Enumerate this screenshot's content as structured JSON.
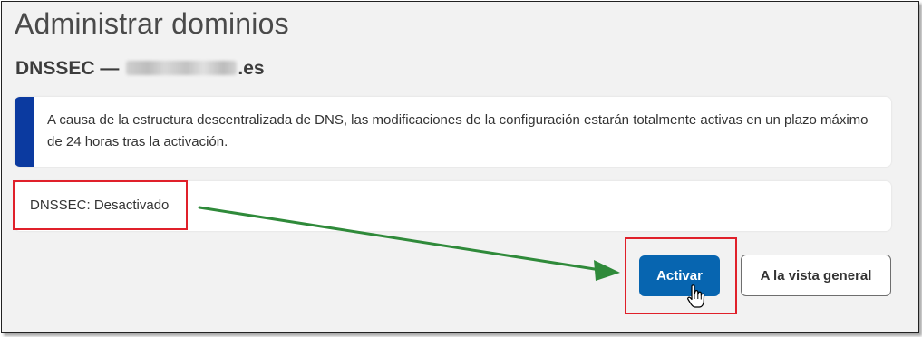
{
  "page": {
    "title": "Administrar dominios",
    "subtitle_prefix": "DNSSEC —",
    "subtitle_suffix": ".es"
  },
  "info": {
    "text": "A causa de la estructura descentralizada de DNS, las modificaciones de la configuración estarán totalmente activas en un plazo máximo de 24 horas tras la activación."
  },
  "status": {
    "text": "DNSSEC: Desactivado"
  },
  "buttons": {
    "activate_label": "Activar",
    "overview_label": "A la vista general"
  },
  "colors": {
    "primary": "#0765b0",
    "info_bar": "#0b3aa0",
    "highlight": "#e0202a",
    "arrow": "#2f8a3a"
  },
  "icons": {
    "cursor": "hand-pointer-icon",
    "annotation_arrow": "arrow-right-icon"
  }
}
